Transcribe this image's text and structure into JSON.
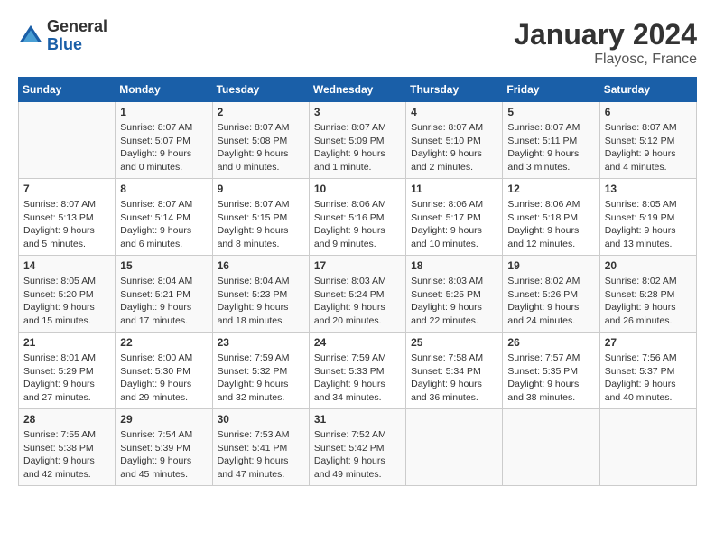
{
  "header": {
    "logo_general": "General",
    "logo_blue": "Blue",
    "title": "January 2024",
    "subtitle": "Flayosc, France"
  },
  "days_of_week": [
    "Sunday",
    "Monday",
    "Tuesday",
    "Wednesday",
    "Thursday",
    "Friday",
    "Saturday"
  ],
  "weeks": [
    [
      {
        "day": "",
        "info": ""
      },
      {
        "day": "1",
        "info": "Sunrise: 8:07 AM\nSunset: 5:07 PM\nDaylight: 9 hours\nand 0 minutes."
      },
      {
        "day": "2",
        "info": "Sunrise: 8:07 AM\nSunset: 5:08 PM\nDaylight: 9 hours\nand 0 minutes."
      },
      {
        "day": "3",
        "info": "Sunrise: 8:07 AM\nSunset: 5:09 PM\nDaylight: 9 hours\nand 1 minute."
      },
      {
        "day": "4",
        "info": "Sunrise: 8:07 AM\nSunset: 5:10 PM\nDaylight: 9 hours\nand 2 minutes."
      },
      {
        "day": "5",
        "info": "Sunrise: 8:07 AM\nSunset: 5:11 PM\nDaylight: 9 hours\nand 3 minutes."
      },
      {
        "day": "6",
        "info": "Sunrise: 8:07 AM\nSunset: 5:12 PM\nDaylight: 9 hours\nand 4 minutes."
      }
    ],
    [
      {
        "day": "7",
        "info": "Sunrise: 8:07 AM\nSunset: 5:13 PM\nDaylight: 9 hours\nand 5 minutes."
      },
      {
        "day": "8",
        "info": "Sunrise: 8:07 AM\nSunset: 5:14 PM\nDaylight: 9 hours\nand 6 minutes."
      },
      {
        "day": "9",
        "info": "Sunrise: 8:07 AM\nSunset: 5:15 PM\nDaylight: 9 hours\nand 8 minutes."
      },
      {
        "day": "10",
        "info": "Sunrise: 8:06 AM\nSunset: 5:16 PM\nDaylight: 9 hours\nand 9 minutes."
      },
      {
        "day": "11",
        "info": "Sunrise: 8:06 AM\nSunset: 5:17 PM\nDaylight: 9 hours\nand 10 minutes."
      },
      {
        "day": "12",
        "info": "Sunrise: 8:06 AM\nSunset: 5:18 PM\nDaylight: 9 hours\nand 12 minutes."
      },
      {
        "day": "13",
        "info": "Sunrise: 8:05 AM\nSunset: 5:19 PM\nDaylight: 9 hours\nand 13 minutes."
      }
    ],
    [
      {
        "day": "14",
        "info": "Sunrise: 8:05 AM\nSunset: 5:20 PM\nDaylight: 9 hours\nand 15 minutes."
      },
      {
        "day": "15",
        "info": "Sunrise: 8:04 AM\nSunset: 5:21 PM\nDaylight: 9 hours\nand 17 minutes."
      },
      {
        "day": "16",
        "info": "Sunrise: 8:04 AM\nSunset: 5:23 PM\nDaylight: 9 hours\nand 18 minutes."
      },
      {
        "day": "17",
        "info": "Sunrise: 8:03 AM\nSunset: 5:24 PM\nDaylight: 9 hours\nand 20 minutes."
      },
      {
        "day": "18",
        "info": "Sunrise: 8:03 AM\nSunset: 5:25 PM\nDaylight: 9 hours\nand 22 minutes."
      },
      {
        "day": "19",
        "info": "Sunrise: 8:02 AM\nSunset: 5:26 PM\nDaylight: 9 hours\nand 24 minutes."
      },
      {
        "day": "20",
        "info": "Sunrise: 8:02 AM\nSunset: 5:28 PM\nDaylight: 9 hours\nand 26 minutes."
      }
    ],
    [
      {
        "day": "21",
        "info": "Sunrise: 8:01 AM\nSunset: 5:29 PM\nDaylight: 9 hours\nand 27 minutes."
      },
      {
        "day": "22",
        "info": "Sunrise: 8:00 AM\nSunset: 5:30 PM\nDaylight: 9 hours\nand 29 minutes."
      },
      {
        "day": "23",
        "info": "Sunrise: 7:59 AM\nSunset: 5:32 PM\nDaylight: 9 hours\nand 32 minutes."
      },
      {
        "day": "24",
        "info": "Sunrise: 7:59 AM\nSunset: 5:33 PM\nDaylight: 9 hours\nand 34 minutes."
      },
      {
        "day": "25",
        "info": "Sunrise: 7:58 AM\nSunset: 5:34 PM\nDaylight: 9 hours\nand 36 minutes."
      },
      {
        "day": "26",
        "info": "Sunrise: 7:57 AM\nSunset: 5:35 PM\nDaylight: 9 hours\nand 38 minutes."
      },
      {
        "day": "27",
        "info": "Sunrise: 7:56 AM\nSunset: 5:37 PM\nDaylight: 9 hours\nand 40 minutes."
      }
    ],
    [
      {
        "day": "28",
        "info": "Sunrise: 7:55 AM\nSunset: 5:38 PM\nDaylight: 9 hours\nand 42 minutes."
      },
      {
        "day": "29",
        "info": "Sunrise: 7:54 AM\nSunset: 5:39 PM\nDaylight: 9 hours\nand 45 minutes."
      },
      {
        "day": "30",
        "info": "Sunrise: 7:53 AM\nSunset: 5:41 PM\nDaylight: 9 hours\nand 47 minutes."
      },
      {
        "day": "31",
        "info": "Sunrise: 7:52 AM\nSunset: 5:42 PM\nDaylight: 9 hours\nand 49 minutes."
      },
      {
        "day": "",
        "info": ""
      },
      {
        "day": "",
        "info": ""
      },
      {
        "day": "",
        "info": ""
      }
    ]
  ]
}
